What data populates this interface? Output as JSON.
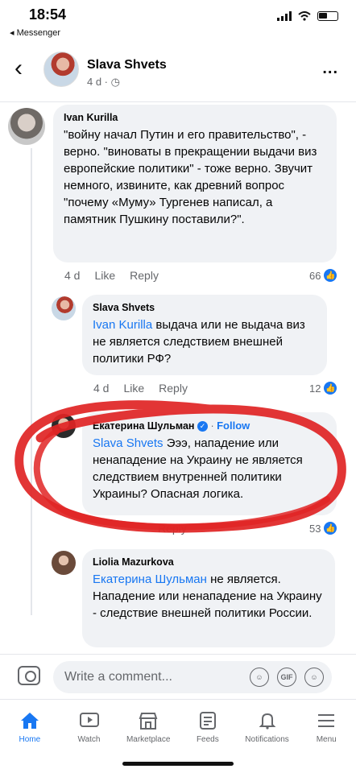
{
  "status": {
    "time": "18:54",
    "back_app": "◂ Messenger"
  },
  "header": {
    "name": "Slava Shvets",
    "meta": "4 d · ◷",
    "more": "..."
  },
  "comments": [
    {
      "author": "Ivan Kurilla",
      "text": "\"войну начал Путин и его правительство\", - верно. \"виноваты в прекращении выдачи виз европейские политики\" - тоже верно. Звучит немного, извините, как древний вопрос \"почему «Муму» Тургенев написал, а памятник Пушкину поставили?\".",
      "time": "4 d",
      "like": "Like",
      "reply": "Reply",
      "count": "66"
    },
    {
      "author": "Slava Shvets",
      "mention": "Ivan Kurilla",
      "text": " выдача или не выдача виз не является следствием внешней политики РФ?",
      "time": "4 d",
      "like": "Like",
      "reply": "Reply",
      "count": "12"
    },
    {
      "author": "Екатерина Шульман",
      "follow": "Follow",
      "mention": "Slava Shvets",
      "text": " Эээ, нападение или ненападение на Украину не является следствием внутренней политики Украины? Опасная логика.",
      "reply": "Reply",
      "count": "53"
    },
    {
      "author": "Liolia  Mazurkova",
      "mention": "Екатерина Шульман",
      "text": " не является. Нападение или ненападение на Украину - следствие внешней политики России."
    }
  ],
  "comment_bar": {
    "placeholder": "Write a comment...",
    "gif": "GIF"
  },
  "tabs": [
    {
      "label": "Home",
      "icon": "home-icon"
    },
    {
      "label": "Watch",
      "icon": "watch-icon"
    },
    {
      "label": "Marketplace",
      "icon": "marketplace-icon"
    },
    {
      "label": "Feeds",
      "icon": "feeds-icon"
    },
    {
      "label": "Notifications",
      "icon": "bell-icon"
    },
    {
      "label": "Menu",
      "icon": "menu-icon"
    }
  ],
  "colors": {
    "accent": "#1877f2",
    "marker": "#e02424"
  }
}
